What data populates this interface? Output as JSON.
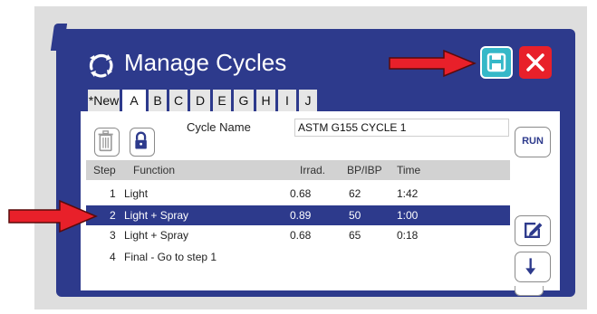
{
  "window": {
    "title": "Manage Cycles"
  },
  "header": {
    "title_icon": "cycle-icon",
    "save_icon": "save-icon",
    "close_icon": "close-icon",
    "save_color": "#35b8c8",
    "close_color": "#e8202a",
    "accent": "#2d3a8c",
    "arrow_color": "#e8202a"
  },
  "tabs": [
    {
      "label": "*New"
    },
    {
      "label": "A",
      "active": true
    },
    {
      "label": "B"
    },
    {
      "label": "C"
    },
    {
      "label": "D"
    },
    {
      "label": "E"
    },
    {
      "label": "G"
    },
    {
      "label": "H"
    },
    {
      "label": "I"
    },
    {
      "label": "J"
    }
  ],
  "toolbar": {
    "delete_icon": "trash-icon",
    "lock_icon": "lock-icon",
    "cycle_name_label": "Cycle Name",
    "cycle_name_value": "ASTM G155 CYCLE 1",
    "run_label": "RUN"
  },
  "table": {
    "columns": [
      "Step",
      "Function",
      "Irrad.",
      "BP/IBP",
      "Time"
    ],
    "rows": [
      {
        "step": "1",
        "function": "Light",
        "irrad": "0.68",
        "bp": "62",
        "time": "1:42"
      },
      {
        "step": "2",
        "function": "Light + Spray",
        "irrad": "0.89",
        "bp": "50",
        "time": "1:00",
        "selected": true
      },
      {
        "step": "3",
        "function": "Light + Spray",
        "irrad": "0.68",
        "bp": "65",
        "time": "0:18"
      },
      {
        "step": "4",
        "function": "Final - Go to step 1",
        "irrad": "",
        "bp": "",
        "time": ""
      }
    ]
  },
  "side_buttons": {
    "edit_icon": "edit-icon",
    "down_icon": "arrow-down-icon"
  }
}
